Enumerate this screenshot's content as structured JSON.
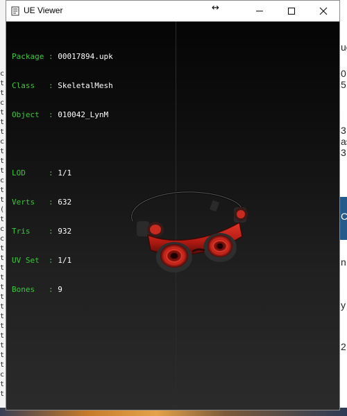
{
  "window": {
    "title": "UE Viewer",
    "resize_glyph": "↔"
  },
  "info_primary": [
    {
      "label": "Package",
      "value": "00017894.upk"
    },
    {
      "label": "Class  ",
      "value": "SkeletalMesh"
    },
    {
      "label": "Object ",
      "value": "010042_LynM"
    }
  ],
  "info_secondary": [
    {
      "label": "LOD    ",
      "value": "1/1"
    },
    {
      "label": "Verts  ",
      "value": "632"
    },
    {
      "label": "Tris   ",
      "value": "932"
    },
    {
      "label": "UV Set ",
      "value": "1/1"
    },
    {
      "label": "Bones  ",
      "value": "9"
    }
  ],
  "background": {
    "left_column": "c\nt\nt\nc\nt\nt\nt\nc\nt\nt\nt\nc\nt\nt\n(\nt\nc\nc\nt\nt\nt\nt\nt\nt\nt\nt\nt\nt\nt\nt\nt\nc\nt\nt",
    "right_fragments": [
      "ue",
      "0",
      "5",
      "3",
      "as",
      "3",
      "C",
      "n",
      "y",
      "2"
    ]
  },
  "colors": {
    "label_green": "#3ec73e",
    "value_white": "#ffffff",
    "axis_blue": "#1a1ab8",
    "goggle_red": "#c41f16"
  }
}
